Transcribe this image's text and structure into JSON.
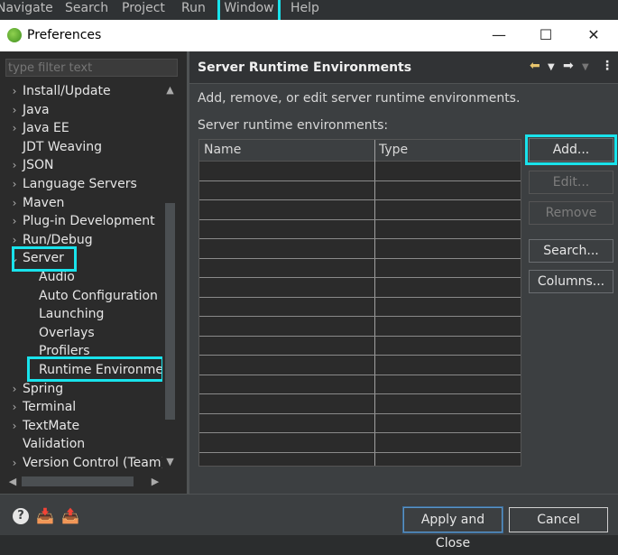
{
  "menubar": {
    "items": [
      "Navigate",
      "Search",
      "Project",
      "Run",
      "Window",
      "Help"
    ]
  },
  "dialog": {
    "title": "Preferences",
    "minimize": "—",
    "maximize": "☐",
    "close": "✕"
  },
  "left": {
    "filter_placeholder": "type filter text",
    "tree": [
      {
        "label": "Install/Update",
        "arrow": "›"
      },
      {
        "label": "Java",
        "arrow": "›"
      },
      {
        "label": "Java EE",
        "arrow": "›"
      },
      {
        "label": "JDT Weaving",
        "arrow": ""
      },
      {
        "label": "JSON",
        "arrow": "›"
      },
      {
        "label": "Language Servers",
        "arrow": "›"
      },
      {
        "label": "Maven",
        "arrow": "›"
      },
      {
        "label": "Plug-in Development",
        "arrow": "›"
      },
      {
        "label": "Run/Debug",
        "arrow": "›"
      },
      {
        "label": "Server",
        "arrow": "⌄"
      },
      {
        "label": "Audio",
        "arrow": ""
      },
      {
        "label": "Auto Configuration",
        "arrow": ""
      },
      {
        "label": "Launching",
        "arrow": ""
      },
      {
        "label": "Overlays",
        "arrow": ""
      },
      {
        "label": "Profilers",
        "arrow": ""
      },
      {
        "label": "Runtime Environment",
        "arrow": ""
      },
      {
        "label": "Spring",
        "arrow": "›"
      },
      {
        "label": "Terminal",
        "arrow": "›"
      },
      {
        "label": "TextMate",
        "arrow": "›"
      },
      {
        "label": "Validation",
        "arrow": ""
      },
      {
        "label": "Version Control (Team)",
        "arrow": "›"
      }
    ]
  },
  "right": {
    "title": "Server Runtime Environments",
    "description": "Add, remove, or edit server runtime environments.",
    "table_label": "Server runtime environments:",
    "columns": [
      "Name",
      "Type"
    ],
    "buttons": {
      "add": "Add...",
      "edit": "Edit...",
      "remove": "Remove",
      "search": "Search...",
      "columns": "Columns..."
    }
  },
  "bottom": {
    "apply_close": "Apply and Close",
    "cancel": "Cancel"
  },
  "colors": {
    "highlight": "#19e3ec",
    "dialog_bg": "#3c3f41",
    "tree_bg": "#2b2b2b"
  }
}
